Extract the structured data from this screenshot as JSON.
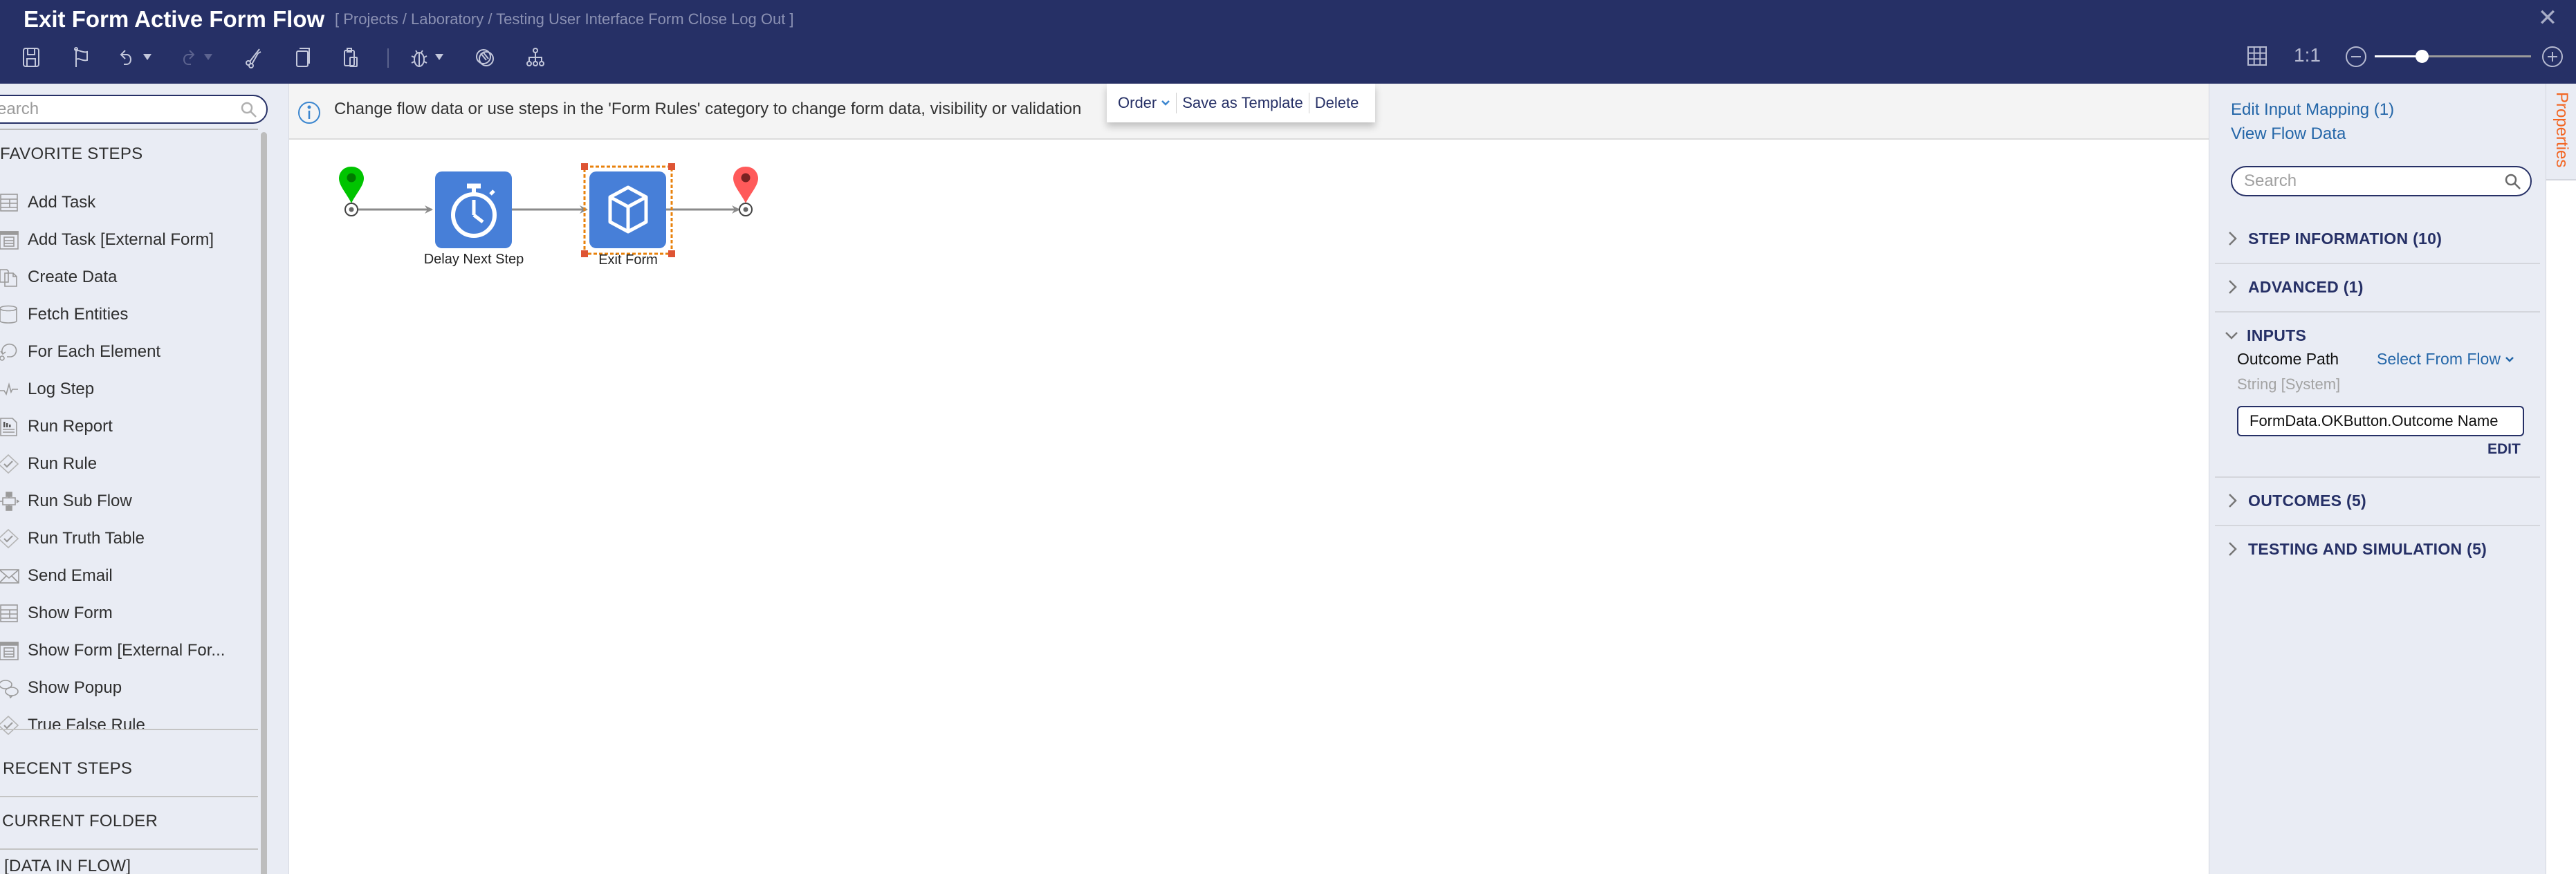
{
  "header": {
    "title": "Exit Form Active Form Flow",
    "breadcrumb": "[ Projects / Laboratory / Testing User Interface Form Close Log Out ]",
    "close_icon": "close-icon"
  },
  "toolbar": {
    "icons": [
      "save-icon",
      "flag-icon",
      "undo-icon",
      "redo-icon",
      "cut-icon",
      "copy-icon",
      "paste-icon",
      "debug-icon",
      "overlap-icon",
      "hierarchy-icon"
    ],
    "grid_icon": "grid-icon",
    "actual_size_label": "1:1",
    "zoom_slider_percent": 30
  },
  "sidebar": {
    "search_placeholder": "Search",
    "favorite_title": "FAVORITE STEPS",
    "favorite_items": [
      {
        "label": "Add Task",
        "icon": "form-icon"
      },
      {
        "label": "Add Task [External Form]",
        "icon": "external-form-icon"
      },
      {
        "label": "Create Data",
        "icon": "documents-icon"
      },
      {
        "label": "Fetch Entities",
        "icon": "database-icon"
      },
      {
        "label": "For Each Element",
        "icon": "loop-icon"
      },
      {
        "label": "Log Step",
        "icon": "pulse-icon"
      },
      {
        "label": "Run Report",
        "icon": "report-icon"
      },
      {
        "label": "Run Rule",
        "icon": "rule-icon"
      },
      {
        "label": "Run Sub Flow",
        "icon": "subflow-icon"
      },
      {
        "label": "Run Truth Table",
        "icon": "rule-icon"
      },
      {
        "label": "Send Email",
        "icon": "email-icon"
      },
      {
        "label": "Show Form",
        "icon": "form-icon"
      },
      {
        "label": "Show Form [External For...",
        "icon": "external-form-icon"
      },
      {
        "label": "Show Popup",
        "icon": "chat-bubbles-icon"
      },
      {
        "label": "True False Rule",
        "icon": "rule-icon"
      }
    ],
    "recent_title": "RECENT STEPS",
    "current_folder_title": "CURRENT FOLDER",
    "data_in_flow_title": "[DATA IN FLOW]"
  },
  "canvas": {
    "info_text": "Change flow data or use steps in the 'Form Rules' category to change form data, visibility or validation",
    "context_menu": {
      "order_label": "Order",
      "save_template_label": "Save as Template",
      "delete_label": "Delete"
    },
    "flow": {
      "nodes": [
        {
          "id": "start",
          "type": "start",
          "color": "#00c400"
        },
        {
          "id": "delay",
          "label": "Delay Next Step",
          "icon": "stopwatch-icon",
          "color": "#477fd8"
        },
        {
          "id": "exit",
          "label": "Exit Form",
          "icon": "cube-icon",
          "color": "#477fd8",
          "selected": true
        },
        {
          "id": "end",
          "type": "end",
          "color": "#ff5a5a"
        }
      ],
      "selection_color": "#e8820c",
      "handle_color": "#de5434"
    }
  },
  "properties": {
    "edit_input_mapping": "Edit Input Mapping (1)",
    "view_flow_data": "View Flow Data",
    "search_placeholder": "Search",
    "sections": {
      "step_information": "STEP INFORMATION (10)",
      "advanced": "ADVANCED (1)",
      "inputs": "INPUTS",
      "outcomes": "OUTCOMES (5)",
      "testing": "TESTING AND SIMULATION (5)"
    },
    "input": {
      "label": "Outcome Path",
      "mode": "Select From Flow",
      "type": "String [System]",
      "value": "FormData.OKButton.Outcome Name",
      "edit_label": "EDIT"
    },
    "tab_label": "Properties"
  },
  "colors": {
    "header_bg": "#263066",
    "panel_bg": "#e9ecf4",
    "link": "#2466a8",
    "accent_orange": "#f26522"
  }
}
